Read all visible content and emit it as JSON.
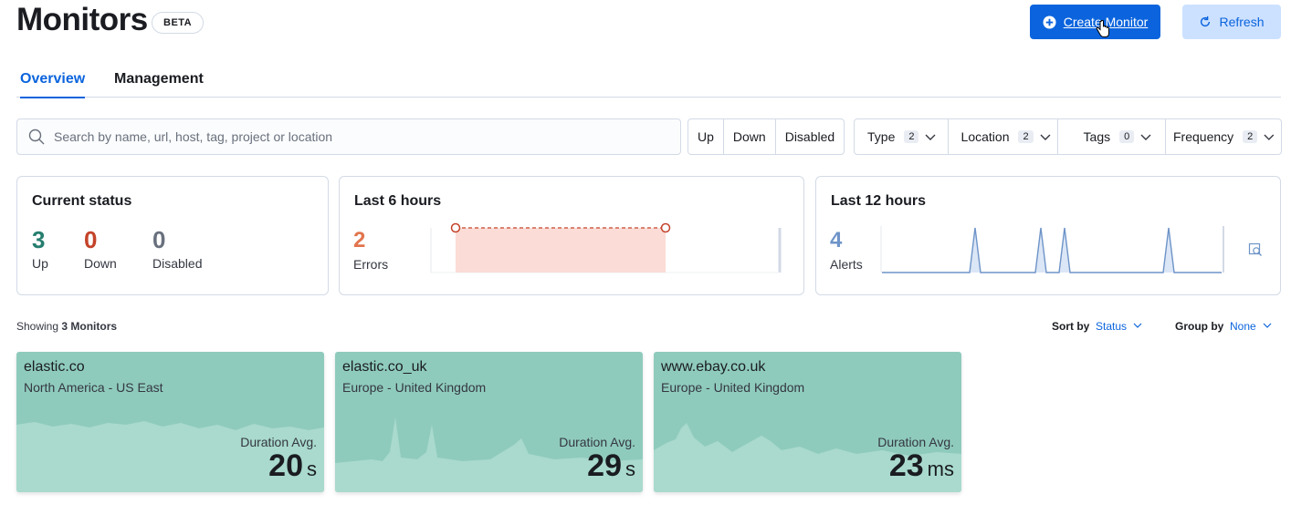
{
  "header": {
    "title": "Monitors",
    "badge": "BETA",
    "create_label": "Create Monitor",
    "refresh_label": "Refresh"
  },
  "tabs": [
    {
      "label": "Overview"
    },
    {
      "label": "Management"
    }
  ],
  "search": {
    "placeholder": "Search by name, url, host, tag, project or location"
  },
  "status_filters": [
    "Up",
    "Down",
    "Disabled"
  ],
  "filters": [
    {
      "label": "Type",
      "count": "2"
    },
    {
      "label": "Location",
      "count": "2"
    },
    {
      "label": "Tags",
      "count": "0"
    },
    {
      "label": "Frequency",
      "count": "2"
    }
  ],
  "current_status": {
    "title": "Current status",
    "up": {
      "value": "3",
      "label": "Up",
      "color": "#267e6f"
    },
    "down": {
      "value": "0",
      "label": "Down",
      "color": "#c4432a"
    },
    "disabled": {
      "value": "0",
      "label": "Disabled",
      "color": "#69707d"
    }
  },
  "last6": {
    "title": "Last 6 hours",
    "value": "2",
    "label": "Errors",
    "color": "#e2744d"
  },
  "last12": {
    "title": "Last 12 hours",
    "value": "4",
    "label": "Alerts",
    "color": "#6e94c8"
  },
  "list": {
    "showing_prefix": "Showing",
    "showing_count": "3 Monitors",
    "sort_label": "Sort by",
    "sort_value": "Status",
    "group_label": "Group by",
    "group_value": "None"
  },
  "monitors": [
    {
      "name": "elastic.co",
      "location": "North America - US East",
      "duration_label": "Duration Avg.",
      "value": "20",
      "unit": "s"
    },
    {
      "name": "elastic.co_uk",
      "location": "Europe - United Kingdom",
      "duration_label": "Duration Avg.",
      "value": "29",
      "unit": "s"
    },
    {
      "name": "www.ebay.co.uk",
      "location": "Europe - United Kingdom",
      "duration_label": "Duration Avg.",
      "value": "23",
      "unit": "ms"
    }
  ],
  "colors": {
    "accent": "#0b64dd",
    "card": "#8fcbbd"
  }
}
